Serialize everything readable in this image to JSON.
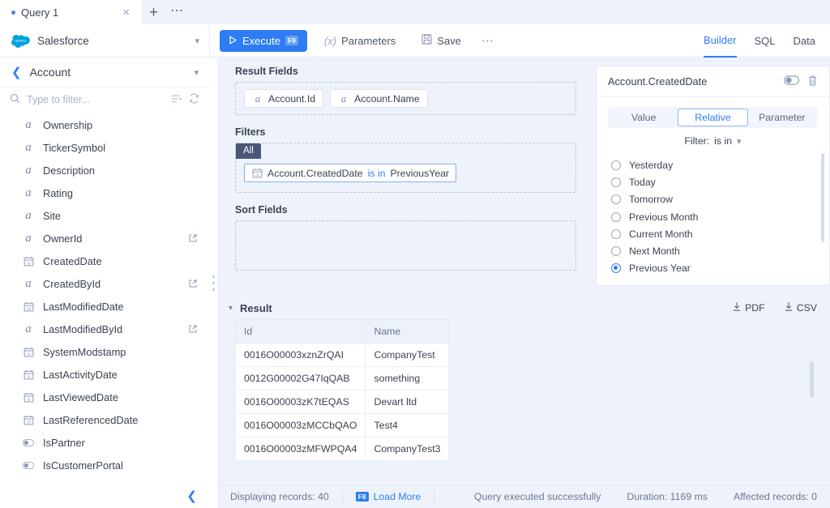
{
  "tabs": {
    "items": [
      {
        "label": "Query 1",
        "close": "×"
      }
    ],
    "add": "+",
    "more": "⋯"
  },
  "toolbar": {
    "connection": "Salesforce",
    "execute_label": "Execute",
    "execute_key": "F9",
    "parameters_prefix": "(x)",
    "parameters_label": "Parameters",
    "save_label": "Save",
    "more": "⋯",
    "right_tabs": [
      {
        "label": "Builder",
        "active": true
      },
      {
        "label": "SQL",
        "active": false
      },
      {
        "label": "Data",
        "active": false
      }
    ]
  },
  "sidebar": {
    "object": "Account",
    "filter_placeholder": "Type to filter...",
    "filter_value": "",
    "fields": [
      {
        "name": "Ownership",
        "type": "text",
        "link": false
      },
      {
        "name": "TickerSymbol",
        "type": "text",
        "link": false
      },
      {
        "name": "Description",
        "type": "text",
        "link": false
      },
      {
        "name": "Rating",
        "type": "text",
        "link": false
      },
      {
        "name": "Site",
        "type": "text",
        "link": false
      },
      {
        "name": "OwnerId",
        "type": "text",
        "link": true
      },
      {
        "name": "CreatedDate",
        "type": "date",
        "link": false
      },
      {
        "name": "CreatedById",
        "type": "text",
        "link": true
      },
      {
        "name": "LastModifiedDate",
        "type": "date",
        "link": false
      },
      {
        "name": "LastModifiedById",
        "type": "text",
        "link": true
      },
      {
        "name": "SystemModstamp",
        "type": "date",
        "link": false
      },
      {
        "name": "LastActivityDate",
        "type": "date",
        "link": false
      },
      {
        "name": "LastViewedDate",
        "type": "date",
        "link": false
      },
      {
        "name": "LastReferencedDate",
        "type": "date",
        "link": false
      },
      {
        "name": "IsPartner",
        "type": "bool",
        "link": false
      },
      {
        "name": "IsCustomerPortal",
        "type": "bool",
        "link": false
      }
    ]
  },
  "builder": {
    "result_fields_label": "Result Fields",
    "result_fields": [
      {
        "name": "Account.Id",
        "type": "text"
      },
      {
        "name": "Account.Name",
        "type": "text"
      }
    ],
    "filters_label": "Filters",
    "filter_group": "All",
    "filters": [
      {
        "field": "Account.CreatedDate",
        "operator": "is in",
        "value": "PreviousYear",
        "type": "date"
      }
    ],
    "sort_fields_label": "Sort Fields",
    "sort_fields": []
  },
  "filter_editor": {
    "title": "Account.CreatedDate",
    "modes": [
      {
        "label": "Value",
        "active": false
      },
      {
        "label": "Relative",
        "active": true
      },
      {
        "label": "Parameter",
        "active": false
      }
    ],
    "filter_prefix": "Filter:",
    "filter_operator": "is in",
    "options": [
      {
        "label": "Yesterday",
        "selected": false
      },
      {
        "label": "Today",
        "selected": false
      },
      {
        "label": "Tomorrow",
        "selected": false
      },
      {
        "label": "Previous Month",
        "selected": false
      },
      {
        "label": "Current Month",
        "selected": false
      },
      {
        "label": "Next Month",
        "selected": false
      },
      {
        "label": "Previous Year",
        "selected": true
      }
    ]
  },
  "result": {
    "title": "Result",
    "export_pdf": "PDF",
    "export_csv": "CSV",
    "columns": [
      "Id",
      "Name"
    ],
    "rows": [
      [
        "0016O00003xznZrQAI",
        "CompanyTest"
      ],
      [
        "0012G00002G47IqQAB",
        "something"
      ],
      [
        "0016O00003zK7tEQAS",
        "Devart ltd"
      ],
      [
        "0016O00003zMCCbQAO",
        "Test4"
      ],
      [
        "0016O00003zMFWPQA4",
        "CompanyTest3"
      ]
    ]
  },
  "status": {
    "displaying": "Displaying records: 40",
    "load_more_key": "F8",
    "load_more": "Load More",
    "query_status": "Query executed successfully",
    "duration": "Duration: 1169 ms",
    "affected": "Affected records: 0"
  },
  "colors": {
    "accent": "#2f7df4",
    "page_bg": "#eef2fb",
    "panel_bg": "#ffffff",
    "group_badge": "#4a5877"
  }
}
